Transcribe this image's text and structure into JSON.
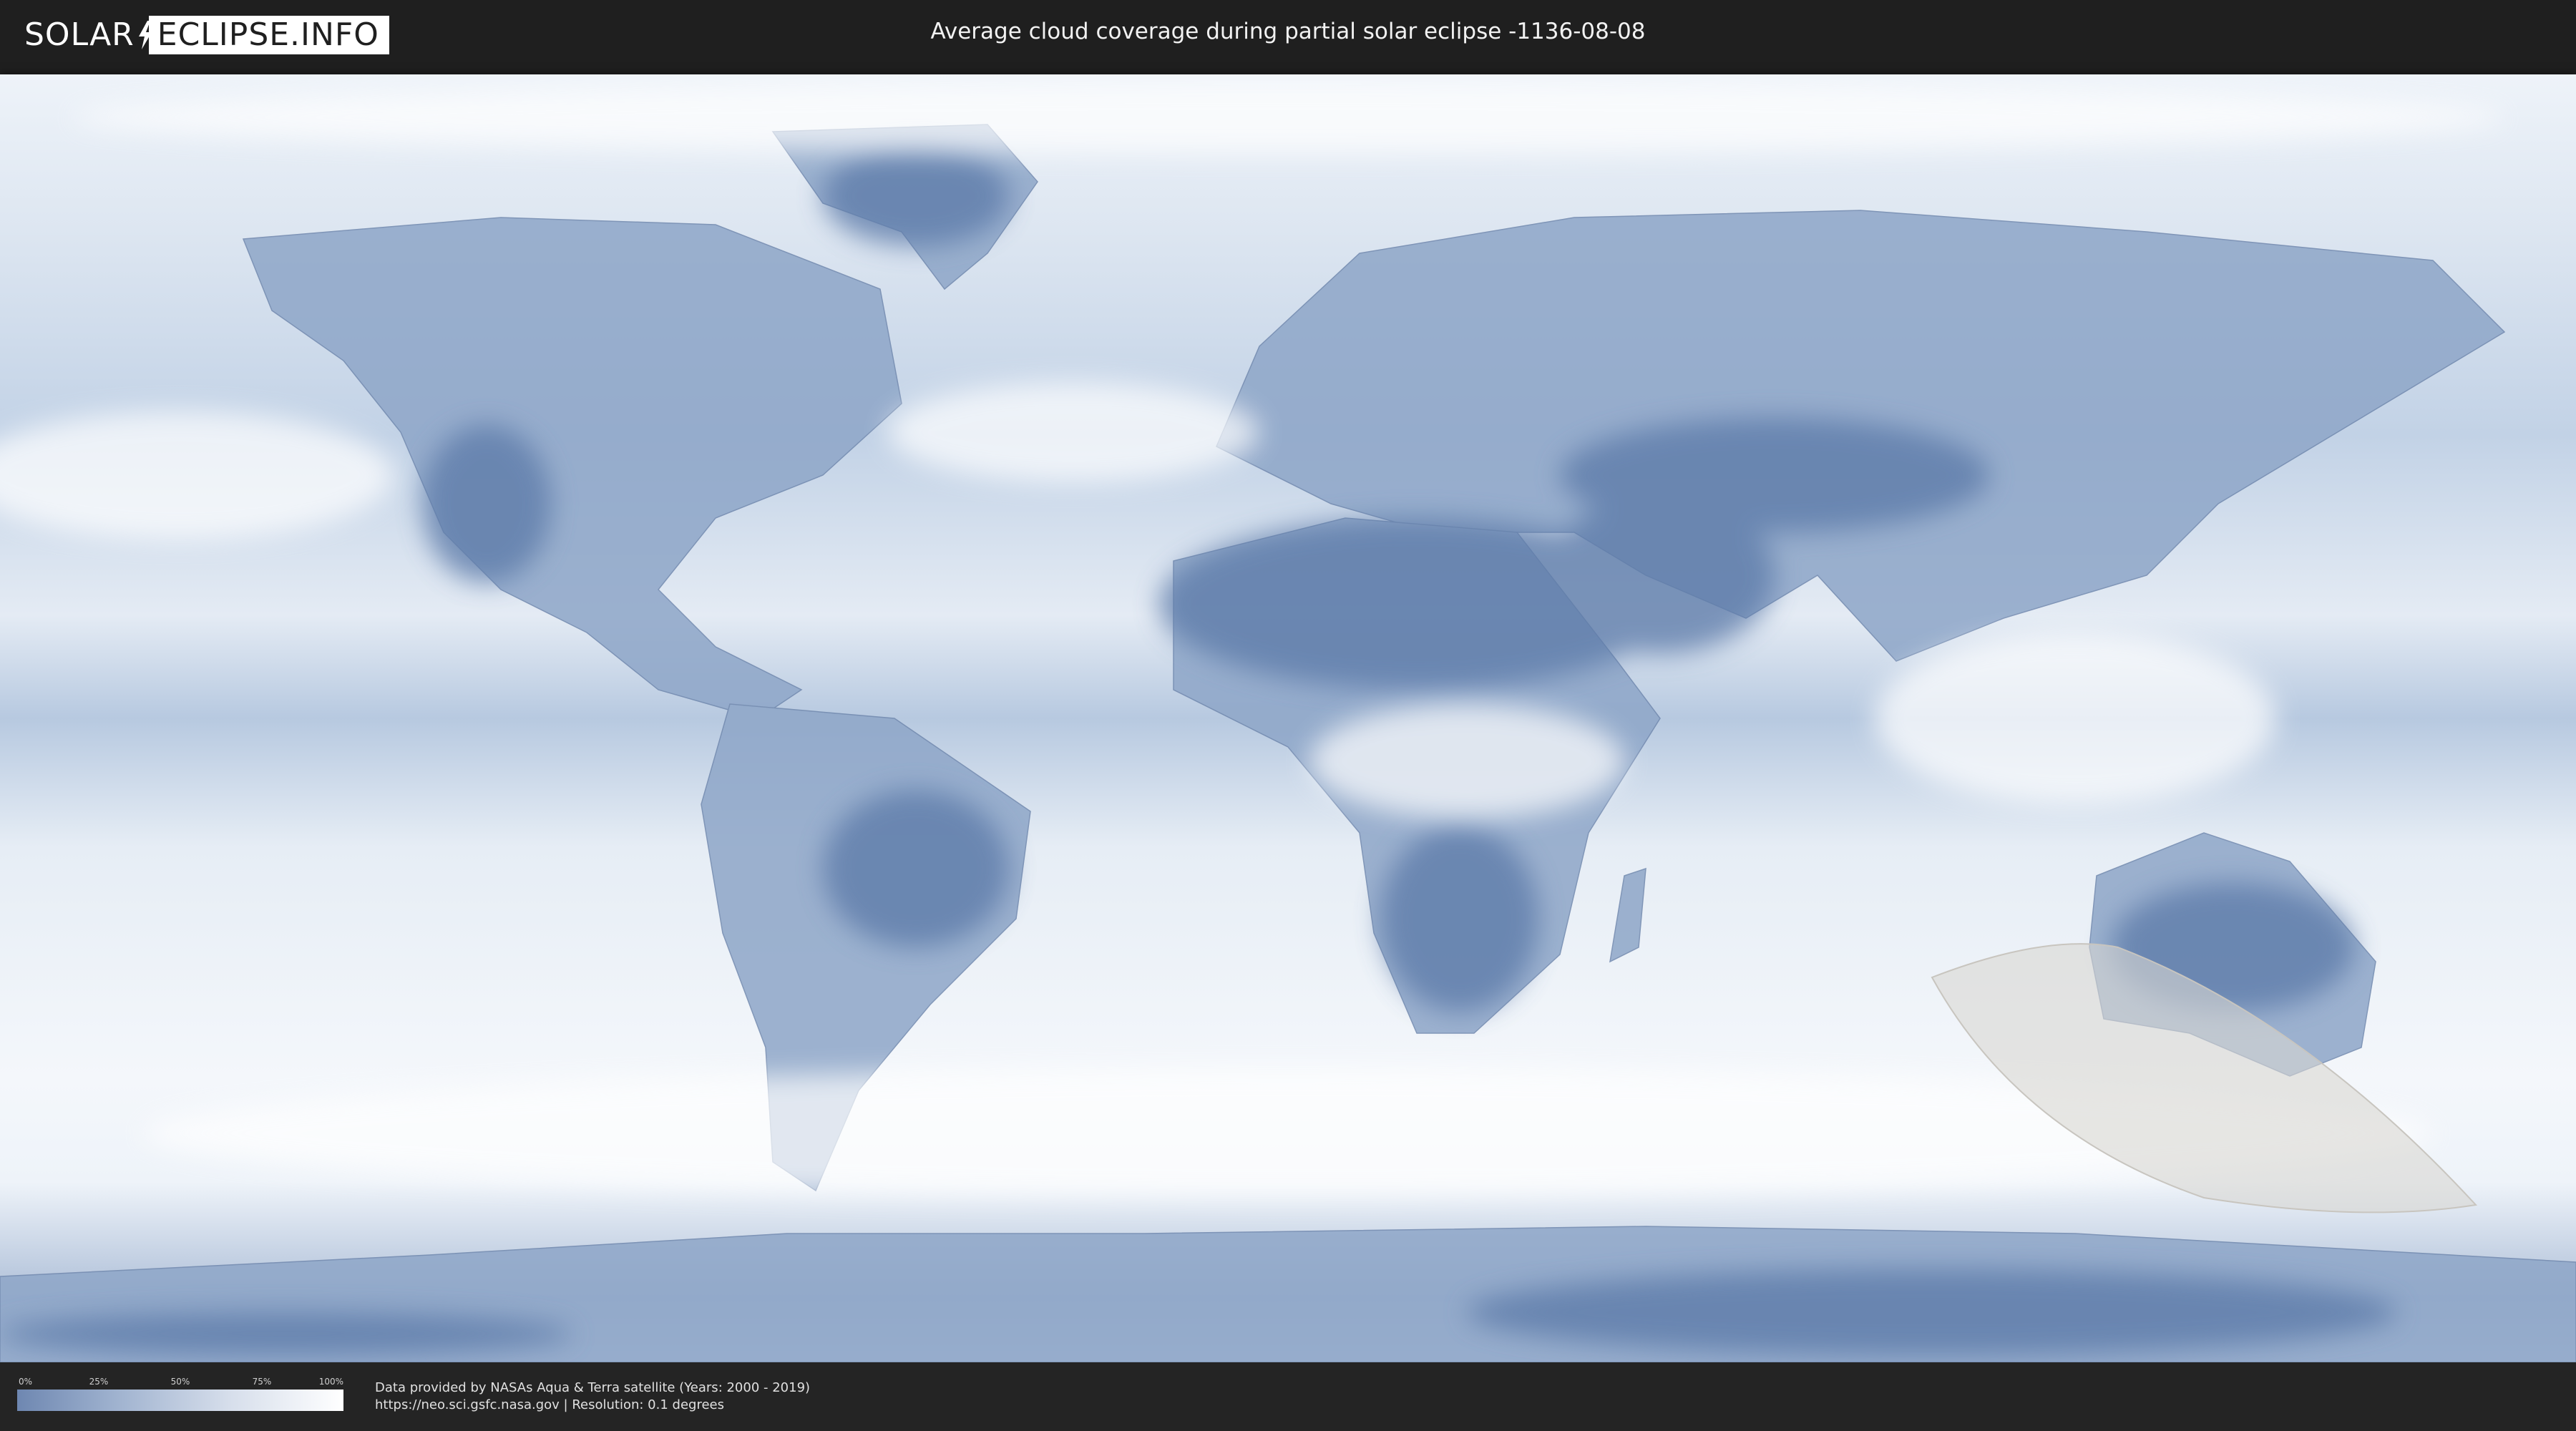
{
  "header": {
    "logo_left": "SOLAR",
    "logo_right": "ECLIPSE.INFO",
    "title": "Average cloud coverage during partial solar eclipse -1136-08-08"
  },
  "map": {
    "projection": "equirectangular",
    "land_color": "#5f7daa",
    "cloud_color": "#ffffff",
    "eclipse_zone_color": "#d9d7d2"
  },
  "legend": {
    "ticks": [
      "0%",
      "25%",
      "50%",
      "75%",
      "100%"
    ],
    "values": [
      0,
      25,
      50,
      75,
      100
    ],
    "gradient": [
      "#6e87b1",
      "#9fb2cf",
      "#d6deeb",
      "#ffffff"
    ]
  },
  "credits": {
    "line1": "Data provided by NASAs Aqua & Terra satellite (Years: 2000 - 2019)",
    "line2": "https://neo.sci.gsfc.nasa.gov | Resolution: 0.1 degrees"
  }
}
